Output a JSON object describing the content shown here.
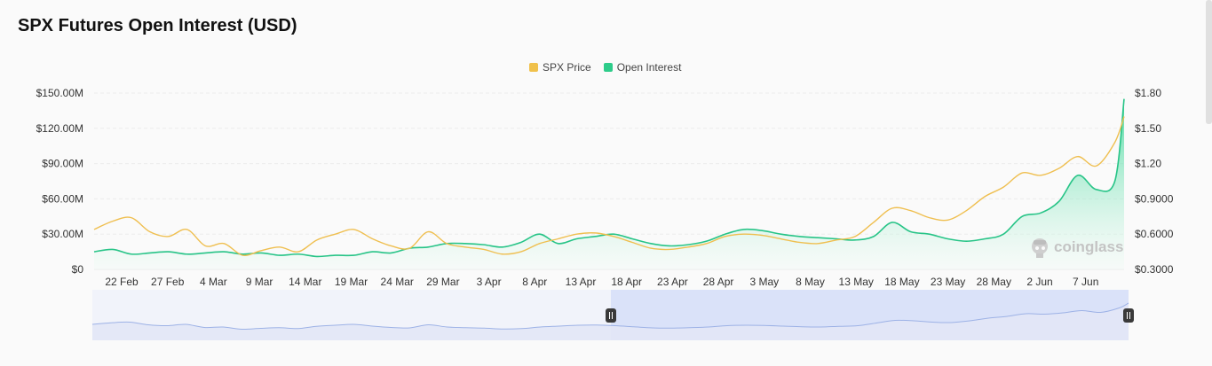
{
  "title": "SPX Futures Open Interest (USD)",
  "legend": [
    {
      "label": "SPX Price",
      "color": "#f0c14b"
    },
    {
      "label": "Open Interest",
      "color": "#2ecc8a"
    }
  ],
  "watermark": "coinglass",
  "colors": {
    "price": "#efbf50",
    "oi_line": "#27c487",
    "oi_fill_top": "#2fd592",
    "oi_fill_bottom": "#ecfbf3",
    "nav_fill": "#e2e7f6",
    "nav_line": "#9db2e6",
    "nav_selected": "#d6def8"
  },
  "chart_data": {
    "type": "line",
    "x_ticks": [
      "22 Feb",
      "27 Feb",
      "4 Mar",
      "9 Mar",
      "14 Mar",
      "19 Mar",
      "24 Mar",
      "29 Mar",
      "3 Apr",
      "8 Apr",
      "13 Apr",
      "18 Apr",
      "23 Apr",
      "28 Apr",
      "3 May",
      "8 May",
      "13 May",
      "18 May",
      "23 May",
      "28 May",
      "2 Jun",
      "7 Jun"
    ],
    "y_left": {
      "ticks": [
        "$0",
        "$30.00M",
        "$60.00M",
        "$90.00M",
        "$120.00M",
        "$150.00M"
      ],
      "range": [
        0,
        150
      ]
    },
    "y_right": {
      "ticks": [
        "$0.3000",
        "$0.6000",
        "$0.9000",
        "$1.20",
        "$1.50",
        "$1.80"
      ],
      "range": [
        0.3,
        1.8
      ]
    },
    "grid": true,
    "legend_position": "top-center",
    "series": [
      {
        "name": "Open Interest",
        "axis": "left",
        "unit": "M USD",
        "x": [
          0,
          2,
          4,
          6,
          8,
          10,
          12,
          14,
          16,
          18,
          20,
          22,
          24,
          26,
          28,
          30,
          32,
          34,
          36,
          38,
          40,
          42,
          44,
          46,
          48,
          50,
          52,
          54,
          56,
          58,
          60,
          62,
          64,
          66,
          68,
          70,
          72,
          74,
          76,
          78,
          80,
          82,
          84,
          86,
          88,
          90,
          92,
          94,
          96,
          98,
          100,
          102,
          104,
          106,
          108,
          110,
          111
        ],
        "values": [
          15,
          17,
          13,
          14,
          15,
          13,
          14,
          15,
          13,
          14,
          12,
          13,
          11,
          12,
          12,
          15,
          14,
          18,
          19,
          22,
          22,
          21,
          19,
          23,
          30,
          22,
          26,
          28,
          30,
          26,
          22,
          20,
          21,
          24,
          30,
          34,
          33,
          30,
          28,
          27,
          26,
          25,
          28,
          40,
          32,
          30,
          26,
          24,
          26,
          30,
          45,
          48,
          58,
          80,
          68,
          75,
          145
        ]
      },
      {
        "name": "SPX Price",
        "axis": "right",
        "unit": "USD",
        "x": [
          0,
          2,
          4,
          6,
          8,
          10,
          12,
          14,
          16,
          18,
          20,
          22,
          24,
          26,
          28,
          30,
          32,
          34,
          36,
          38,
          40,
          42,
          44,
          46,
          48,
          50,
          52,
          54,
          56,
          58,
          60,
          62,
          64,
          66,
          68,
          70,
          72,
          74,
          76,
          78,
          80,
          82,
          84,
          86,
          88,
          90,
          92,
          94,
          96,
          98,
          100,
          102,
          104,
          106,
          108,
          110,
          111
        ],
        "values": [
          0.64,
          0.71,
          0.74,
          0.62,
          0.58,
          0.64,
          0.5,
          0.52,
          0.42,
          0.46,
          0.49,
          0.45,
          0.55,
          0.6,
          0.64,
          0.56,
          0.5,
          0.48,
          0.62,
          0.52,
          0.49,
          0.47,
          0.43,
          0.45,
          0.52,
          0.56,
          0.6,
          0.61,
          0.58,
          0.53,
          0.48,
          0.47,
          0.49,
          0.52,
          0.58,
          0.6,
          0.59,
          0.56,
          0.53,
          0.52,
          0.55,
          0.58,
          0.7,
          0.82,
          0.8,
          0.74,
          0.72,
          0.8,
          0.92,
          1.0,
          1.12,
          1.1,
          1.16,
          1.26,
          1.18,
          1.38,
          1.6
        ]
      }
    ]
  }
}
